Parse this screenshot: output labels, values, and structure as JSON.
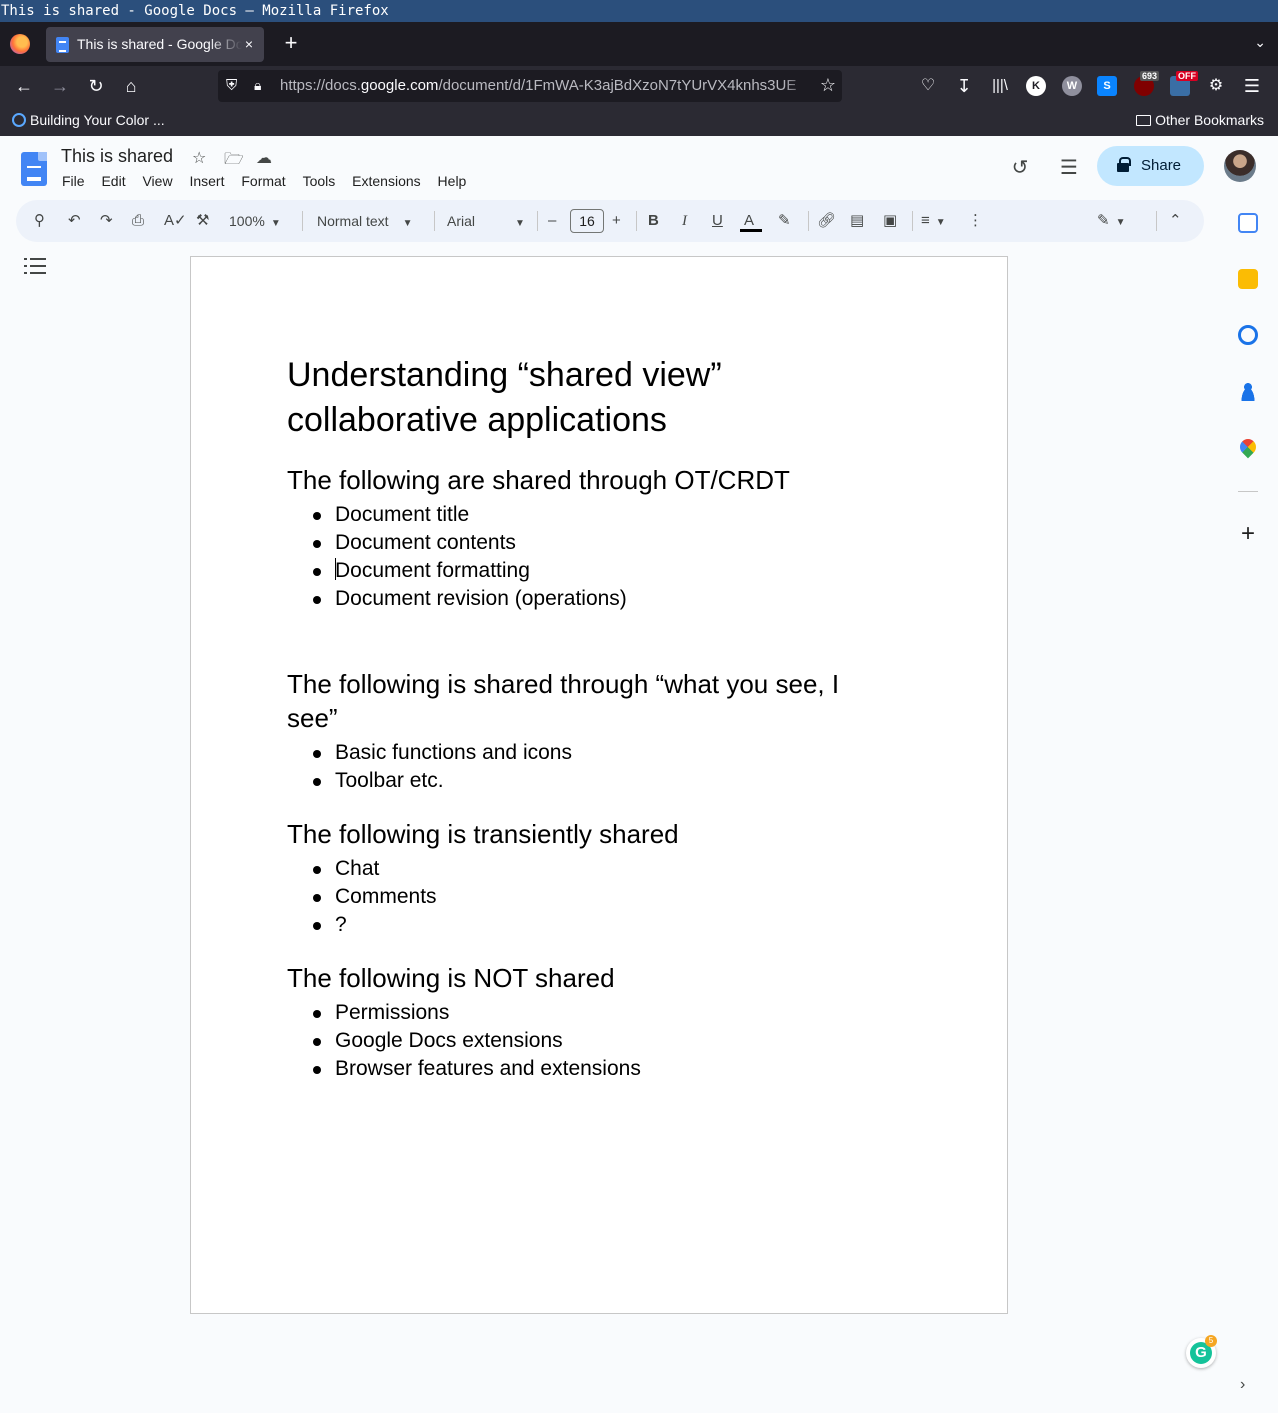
{
  "os": {
    "window_title": "This is shared - Google Docs — Mozilla Firefox"
  },
  "browser": {
    "tab_title": "This is shared - Google Docs",
    "tab_close": "×",
    "new_tab": "+",
    "url_host_prefix": "https://docs.",
    "url_host": "google.com",
    "url_path": "/document/d/1FmWA-K3ajBdXzoN7tYUrVX4knhs3UE",
    "extensions": {
      "ublock_badge": "693",
      "toggle_badge": "OFF",
      "k_label": "K",
      "w_label": "W",
      "s_label": "S"
    },
    "bookmarks": {
      "item1": "Building Your Color ...",
      "other": "Other Bookmarks"
    }
  },
  "docs": {
    "title": "This is shared",
    "menu": [
      "File",
      "Edit",
      "View",
      "Insert",
      "Format",
      "Tools",
      "Extensions",
      "Help"
    ],
    "share_label": "Share",
    "toolbar": {
      "zoom": "100%",
      "style": "Normal text",
      "font": "Arial",
      "font_size": "16"
    }
  },
  "document": {
    "heading": "Understanding “shared view” collaborative applications",
    "sections": [
      {
        "title": "The following are shared through OT/CRDT",
        "items": [
          "Document title",
          "Document contents",
          "Document formatting",
          "Document revision (operations)"
        ]
      },
      {
        "title": "The following is shared through “what you see, I see”",
        "items": [
          "Basic functions and icons",
          "Toolbar etc."
        ]
      },
      {
        "title": "The following is transiently shared",
        "items": [
          "Chat",
          "Comments",
          "?"
        ]
      },
      {
        "title": "The following is NOT shared",
        "items": [
          "Permissions",
          "Google Docs extensions",
          "Browser features and extensions"
        ]
      }
    ]
  },
  "grammarly": {
    "count": "5"
  },
  "colors": {
    "accent": "#4285f4",
    "share_bg": "#c2e7ff",
    "toolbar_bg": "#edf2fa",
    "os_title_bg": "#2b4f7c"
  }
}
